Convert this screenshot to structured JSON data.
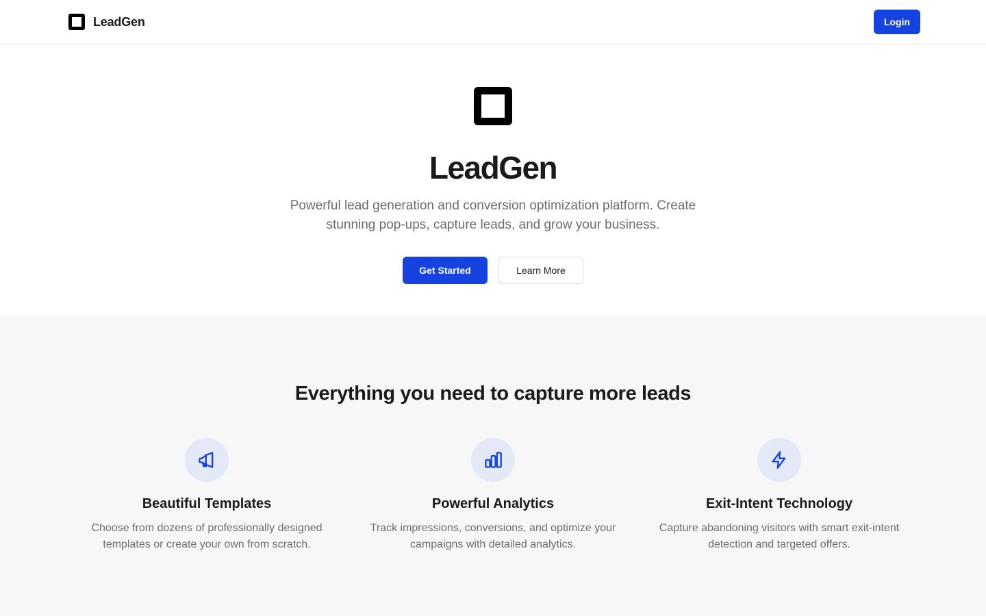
{
  "header": {
    "brand_name": "LeadGen",
    "login_label": "Login"
  },
  "hero": {
    "title": "LeadGen",
    "subtitle": "Powerful lead generation and conversion optimization platform. Create stunning pop-ups, capture leads, and grow your business.",
    "primary_cta": "Get Started",
    "secondary_cta": "Learn More"
  },
  "features": {
    "title": "Everything you need to capture more leads",
    "items": [
      {
        "icon": "megaphone-icon",
        "title": "Beautiful Templates",
        "description": "Choose from dozens of professionally designed templates or create your own from scratch."
      },
      {
        "icon": "bar-chart-icon",
        "title": "Powerful Analytics",
        "description": "Track impressions, conversions, and optimize your campaigns with detailed analytics."
      },
      {
        "icon": "lightning-icon",
        "title": "Exit-Intent Technology",
        "description": "Capture abandoning visitors with smart exit-intent detection and targeted offers."
      }
    ]
  },
  "colors": {
    "accent": "#1642e0",
    "icon_bg": "#e4e9f7",
    "section_bg": "#f7f7f7",
    "muted_text": "#6b6b73"
  }
}
